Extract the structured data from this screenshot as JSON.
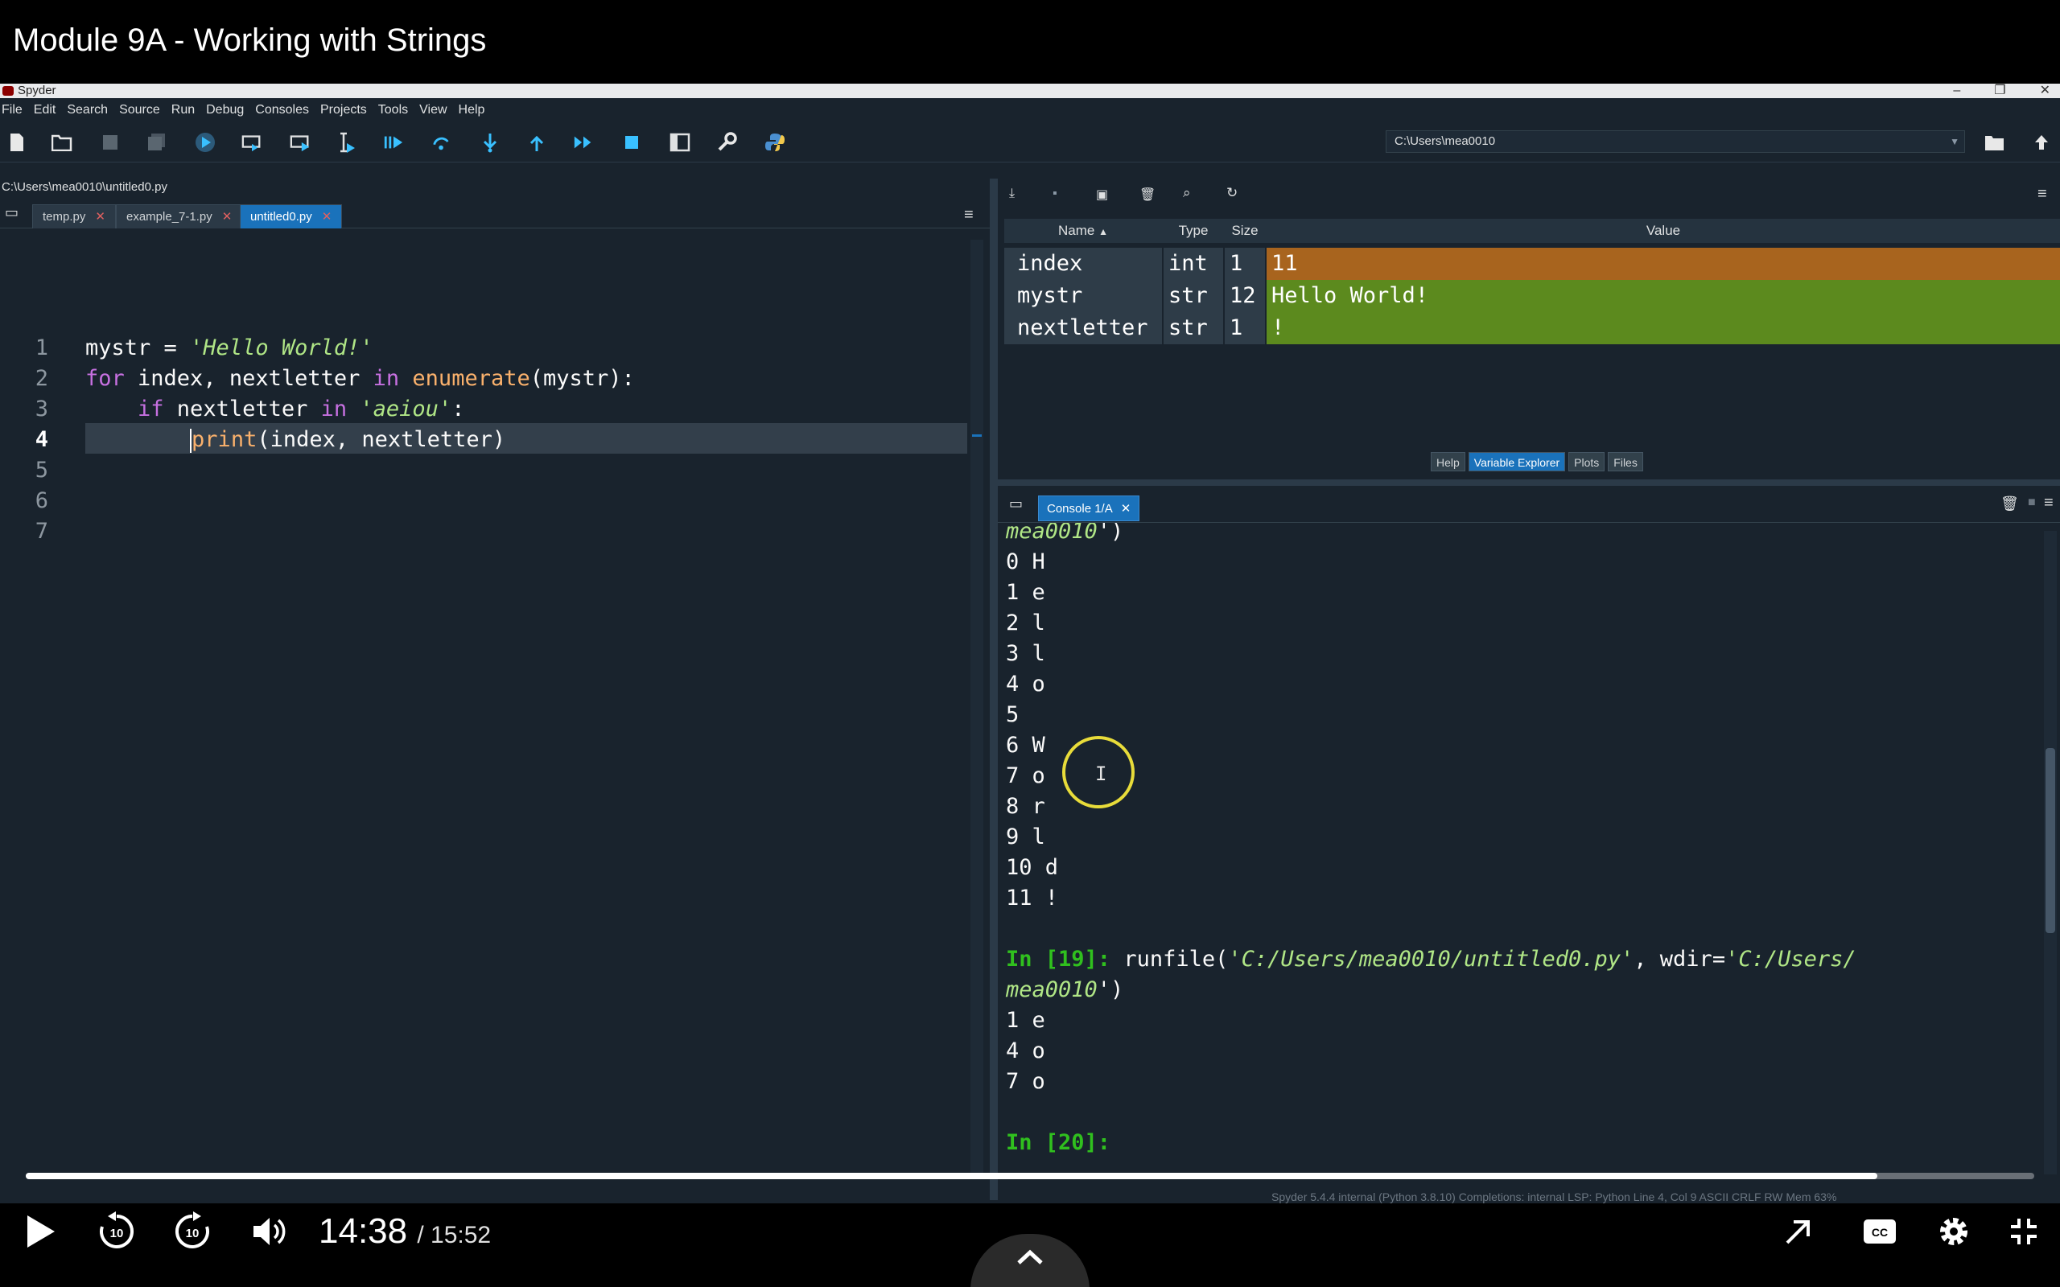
{
  "video": {
    "title": "Module 9A - Working with Strings",
    "current_time": "14:38",
    "duration": "/ 15:52",
    "progress": 0.922,
    "colors": {
      "progress_fill": "#ffffff",
      "background": "#000000"
    }
  },
  "spyder": {
    "window_title": "Spyder",
    "menu": [
      "File",
      "Edit",
      "Search",
      "Source",
      "Run",
      "Debug",
      "Consoles",
      "Projects",
      "Tools",
      "View",
      "Help"
    ],
    "working_dir": "C:\\Users\\mea0010",
    "editor": {
      "file_path": "C:\\Users\\mea0010\\untitled0.py",
      "tabs": [
        {
          "label": "temp.py"
        },
        {
          "label": "example_7-1.py"
        },
        {
          "label": "untitled0.py",
          "active": true
        }
      ],
      "line_numbers": [
        "1",
        "2",
        "3",
        "4",
        "5",
        "6",
        "7"
      ],
      "current_line": 4
    },
    "variable_explorer": {
      "columns": [
        "Name",
        "Type",
        "Size",
        "Value"
      ],
      "rows": [
        {
          "name": "index",
          "type": "int",
          "size": "1",
          "value": "11",
          "color": "#a8641e"
        },
        {
          "name": "mystr",
          "type": "str",
          "size": "12",
          "value": "Hello World!",
          "color": "#5c8a1e"
        },
        {
          "name": "nextletter",
          "type": "str",
          "size": "1",
          "value": "!",
          "color": "#5c8a1e"
        }
      ],
      "pane_tabs": [
        "Help",
        "Variable Explorer",
        "Plots",
        "Files"
      ],
      "active_tab": "Variable Explorer"
    },
    "console": {
      "tab_label": "Console 1/A",
      "output_before": [
        "0 H",
        "1 e",
        "2 l",
        "3 l",
        "4 o",
        "5",
        "6 W",
        "7 o",
        "8 r",
        "9 l",
        "10 d",
        "11 !"
      ],
      "run_prompt": "In [19]:",
      "run_cmd_prefix": "runfile(",
      "run_file": "'C:/Users/mea0010/untitled0.py'",
      "run_mid": ", wdir=",
      "run_wdir_a": "'C:/Users/",
      "run_wdir_b": "mea0010",
      "run_close": "')",
      "output_after": [
        "1 e",
        "4 o",
        "7 o"
      ],
      "next_prompt": "In [20]:"
    },
    "status_bar": "Spyder 5.4.4   internal (Python 3.8.10)   Completions: internal   LSP: Python   Line 4, Col 9   ASCII   CRLF   RW   Mem 63%"
  }
}
